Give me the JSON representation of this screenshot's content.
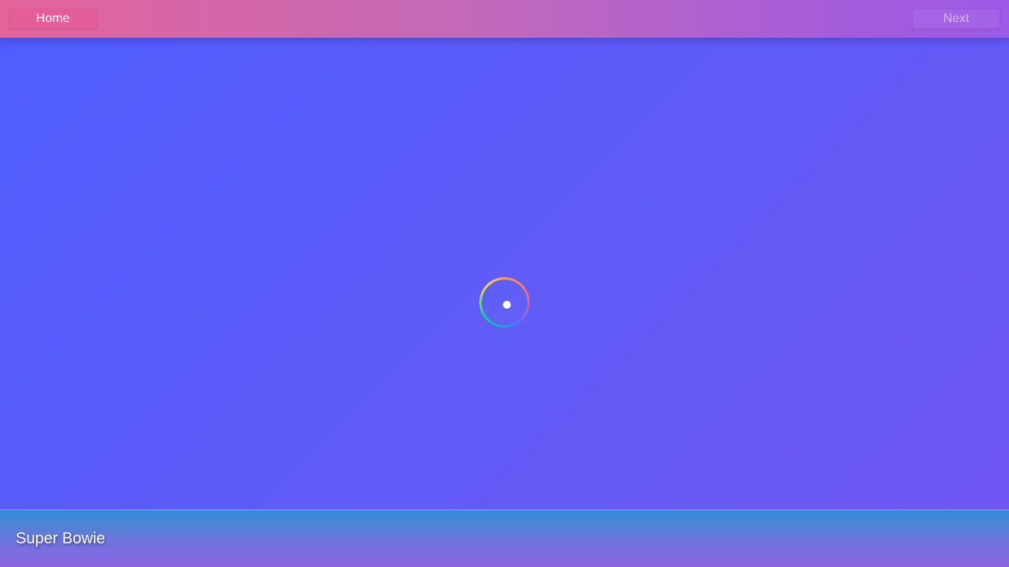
{
  "nav": {
    "home_label": "Home",
    "next_label": "Next"
  },
  "loader": {
    "icon": "loading-spinner-icon"
  },
  "footer": {
    "title": "Super Bowie"
  },
  "colors": {
    "background_start": "#4f5eff",
    "background_end": "#7056f2",
    "topbar_start": "#e4649a",
    "topbar_end": "#9c5ae6"
  }
}
